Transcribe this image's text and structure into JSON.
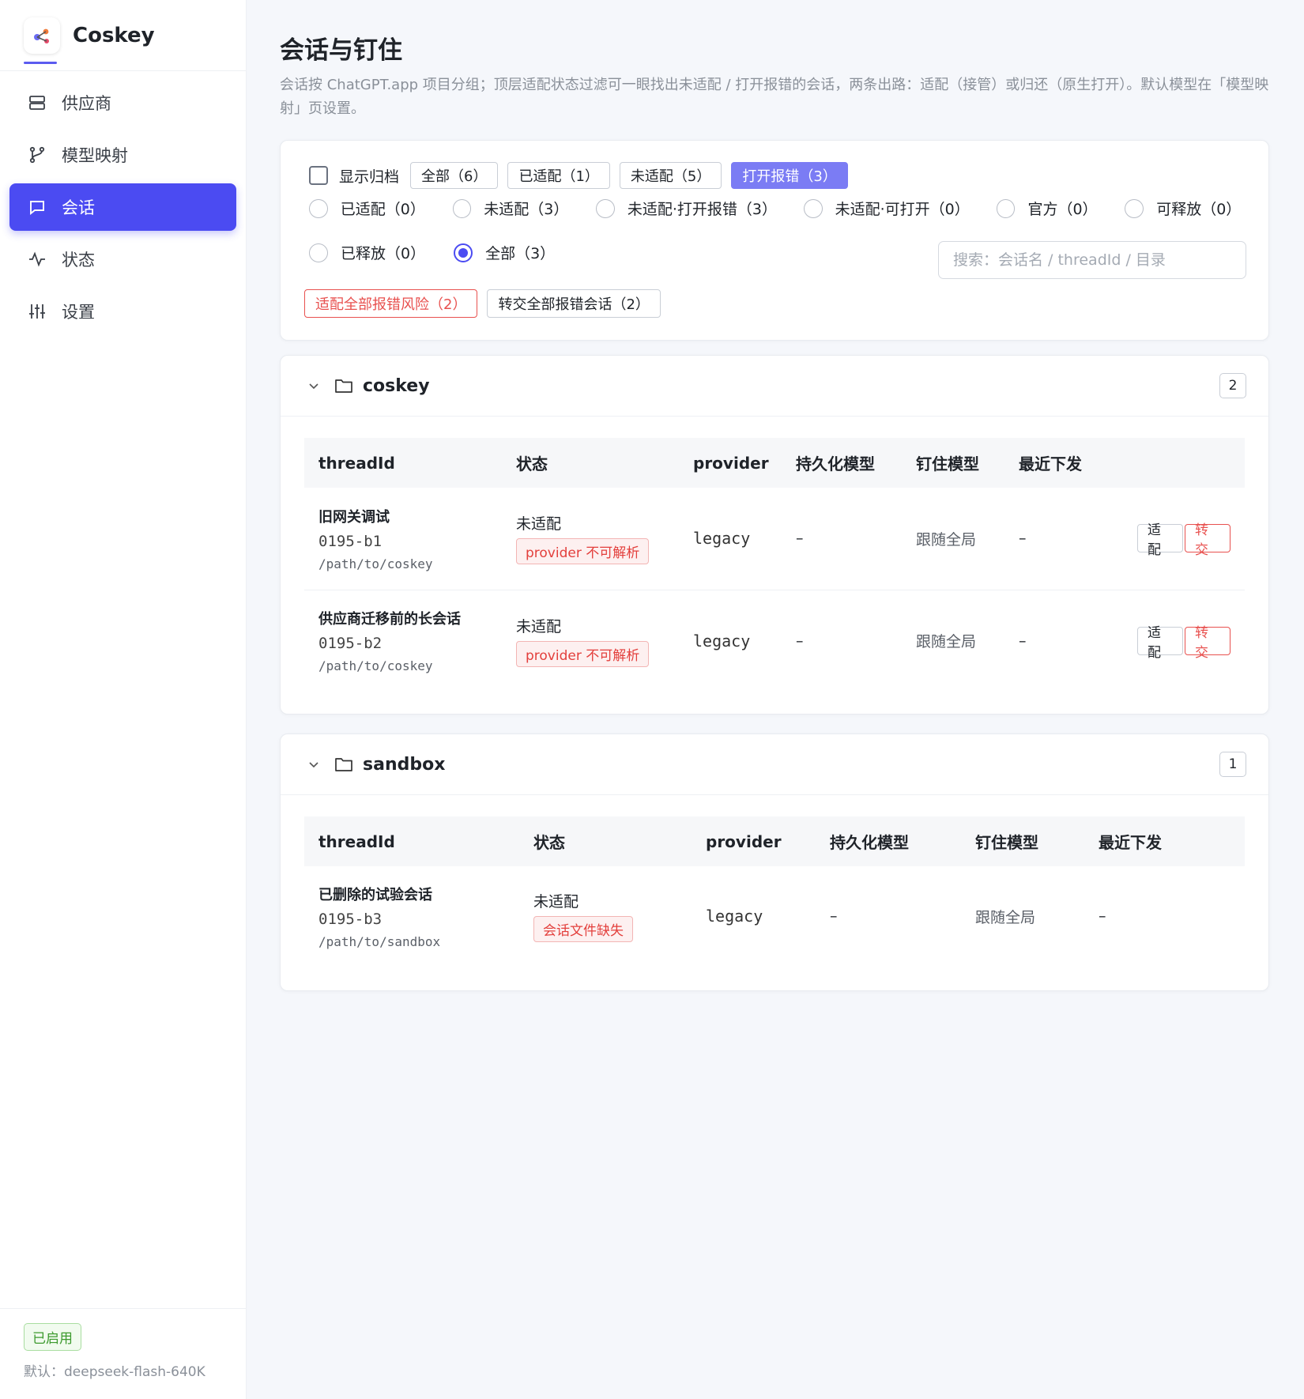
{
  "brand": {
    "name": "Coskey"
  },
  "nav": [
    {
      "label": "供应商",
      "icon": "server-icon"
    },
    {
      "label": "模型映射",
      "icon": "branch-icon"
    },
    {
      "label": "会话",
      "icon": "chat-icon",
      "active": true
    },
    {
      "label": "状态",
      "icon": "pulse-icon"
    },
    {
      "label": "设置",
      "icon": "sliders-icon"
    }
  ],
  "footer": {
    "badge": "已启用",
    "default_model": "默认：deepseek-flash-640K"
  },
  "page": {
    "title": "会话与钉住",
    "description": "会话按 ChatGPT.app 项目分组；顶层适配状态过滤可一眼找出未适配 / 打开报错的会话，两条出路：适配（接管）或归还（原生打开）。默认模型在「模型映射」页设置。"
  },
  "filters": {
    "show_archived": "显示归档",
    "chips": [
      "全部（6）",
      "已适配（1）",
      "未适配（5）",
      "打开报错（3）"
    ],
    "active_chip": 3,
    "radios": [
      "已适配（0）",
      "未适配（3）",
      "未适配·打开报错（3）",
      "未适配·可打开（0）",
      "官方（0）",
      "可释放（0）",
      "已释放（0）",
      "全部（3）"
    ],
    "checked_radio": 7,
    "search_placeholder": "搜索：会话名 / threadId / 目录",
    "bulk_adapt": "适配全部报错风险（2）",
    "bulk_transfer": "转交全部报错会话（2）"
  },
  "columns": [
    "threadId",
    "状态",
    "provider",
    "持久化模型",
    "钉住模型",
    "最近下发"
  ],
  "groups": [
    {
      "name": "coskey",
      "count": "2",
      "rows": [
        {
          "name": "旧网关调试",
          "id": "0195-b1",
          "path": "/path/to/coskey",
          "status": "未适配",
          "tag": "provider 不可解析",
          "provider": "legacy",
          "persisted": "–",
          "pinned": "跟随全局",
          "recent": "–",
          "adapt": "适配",
          "transfer": "转交"
        },
        {
          "name": "供应商迁移前的长会话",
          "id": "0195-b2",
          "path": "/path/to/coskey",
          "status": "未适配",
          "tag": "provider 不可解析",
          "provider": "legacy",
          "persisted": "–",
          "pinned": "跟随全局",
          "recent": "–",
          "adapt": "适配",
          "transfer": "转交"
        }
      ]
    },
    {
      "name": "sandbox",
      "count": "1",
      "rows": [
        {
          "name": "已删除的试验会话",
          "id": "0195-b3",
          "path": "/path/to/sandbox",
          "status": "未适配",
          "tag": "会话文件缺失",
          "provider": "legacy",
          "persisted": "–",
          "pinned": "跟随全局",
          "recent": "–"
        }
      ]
    }
  ]
}
